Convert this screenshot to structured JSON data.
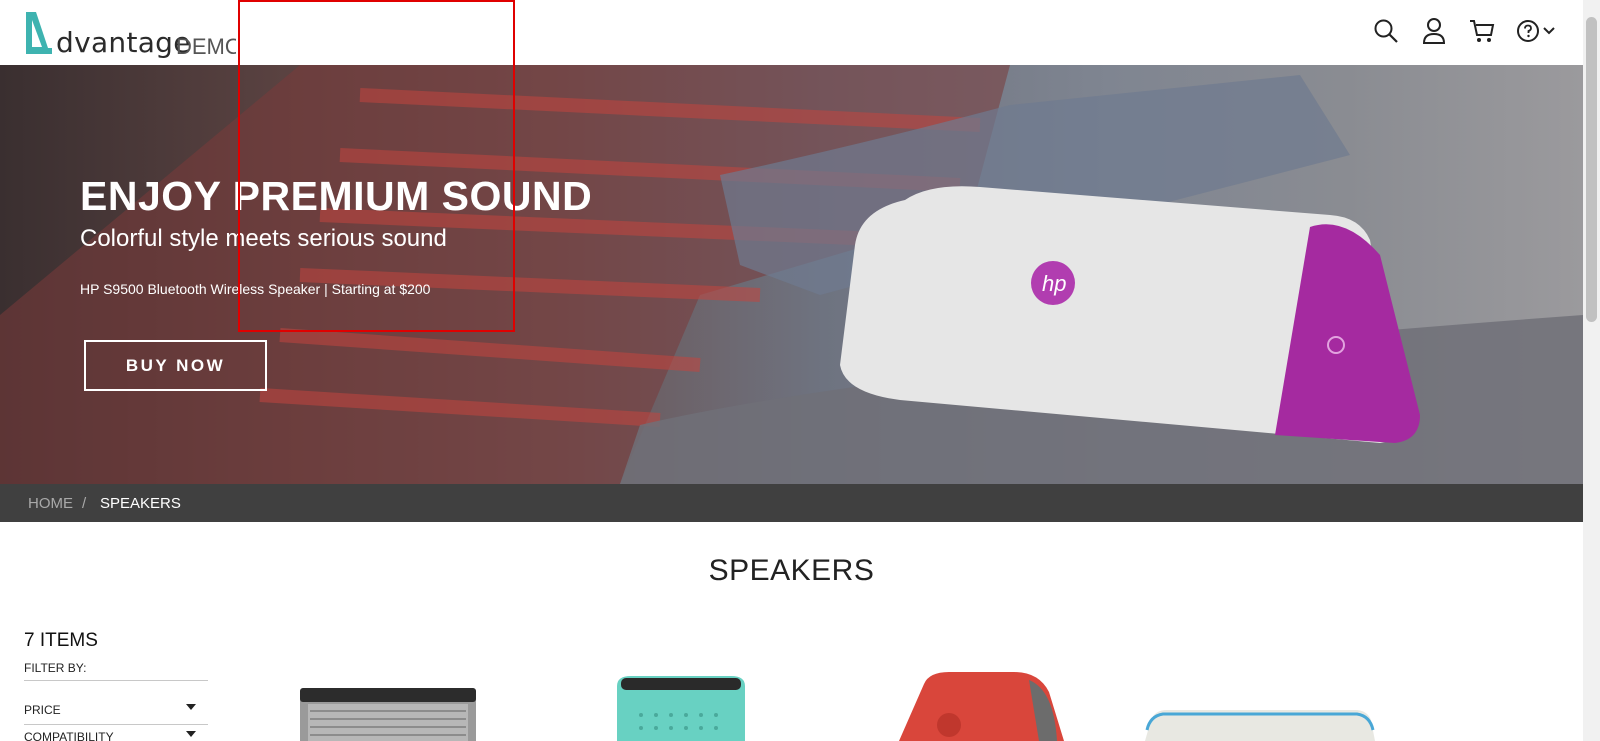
{
  "header": {
    "logo_text": "dvantage",
    "logo_sub": "DEMO",
    "icons": [
      "search-icon",
      "user-icon",
      "cart-icon",
      "help-icon",
      "chevron-down-icon"
    ]
  },
  "hero": {
    "title": "ENJOY PREMIUM SOUND",
    "subtitle": "Colorful style meets serious sound",
    "description": "HP S9500 Bluetooth Wireless Speaker | Starting at $200",
    "button_label": "BUY NOW"
  },
  "breadcrumb": {
    "home": "HOME",
    "separator": "/",
    "current": "SPEAKERS"
  },
  "main": {
    "page_title": "SPEAKERS",
    "items_count": "7 ITEMS",
    "filter_label": "FILTER BY:",
    "filters": [
      "PRICE",
      "COMPATIBILITY"
    ]
  },
  "products": [
    {
      "icon": "bose-soundlink-speaker-image"
    },
    {
      "icon": "bose-soundlink-color-speaker-image"
    },
    {
      "icon": "hp-roar-red-speaker-image"
    },
    {
      "icon": "white-speaker-image"
    }
  ],
  "colors": {
    "accent": "#3eb3b0",
    "highlight_box": "#e00000",
    "breadcrumb_bg": "#404040"
  }
}
